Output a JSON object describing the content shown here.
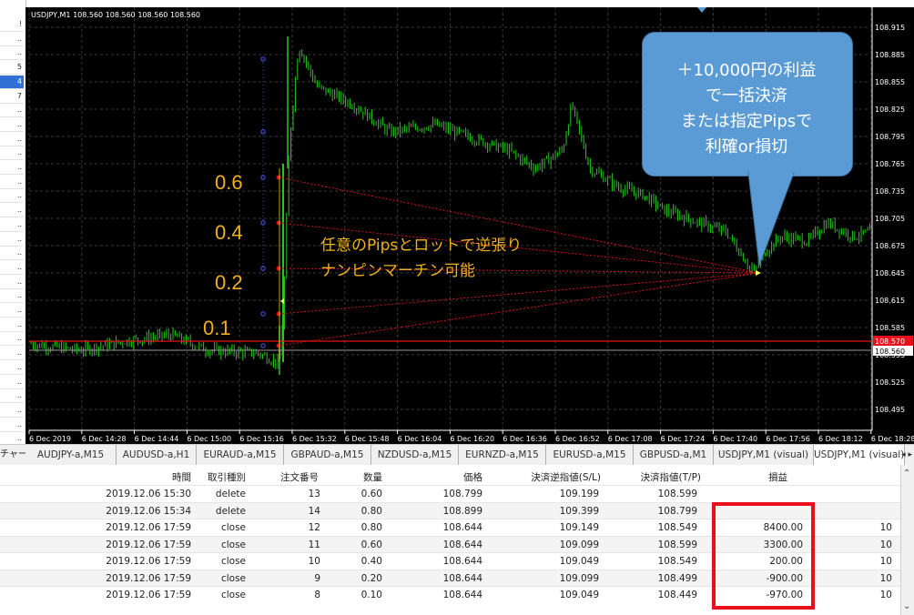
{
  "left_panel": {
    "rows": [
      "!",
      "..",
      "..",
      "5",
      "4",
      "7",
      "..",
      "..",
      "..",
      "..",
      "..",
      "..",
      "..",
      "..",
      "..",
      "..",
      "..",
      "..",
      "..",
      "..",
      "..",
      "..",
      "..",
      "..",
      "..",
      "..",
      "..",
      "..",
      "..",
      "..",
      "v"
    ]
  },
  "chart": {
    "header": "USDJPY,M1  108.560 108.560 108.560 108.560",
    "price_labels": [
      "108.915",
      "108.885",
      "108.855",
      "108.825",
      "108.795",
      "108.765",
      "108.735",
      "108.705",
      "108.675",
      "108.645",
      "108.615",
      "108.585",
      "108.555",
      "108.525",
      "108.495"
    ],
    "red_line_label": "108.570",
    "current_price_label": "108.560",
    "time_labels": [
      "6 Dec 2019",
      "6 Dec 14:28",
      "6 Dec 14:44",
      "6 Dec 15:00",
      "6 Dec 15:16",
      "6 Dec 15:32",
      "6 Dec 15:48",
      "6 Dec 16:04",
      "6 Dec 16:20",
      "6 Dec 16:36",
      "6 Dec 16:52",
      "6 Dec 17:08",
      "6 Dec 17:24",
      "6 Dec 17:40",
      "6 Dec 17:56",
      "6 Dec 18:12",
      "6 Dec 18:28"
    ],
    "levels": [
      "0.6",
      "0.4",
      "0.2",
      "0.1"
    ],
    "annotation_line1": "任意のPipsとロットで逆張り",
    "annotation_line2": "ナンピンマーチン可能",
    "callout_lines": [
      "＋10,000円の利益",
      "で一括決済",
      "または指定Pipsで",
      "利確or損切"
    ],
    "colors": {
      "bg": "#000000",
      "grid": "#3a3a3a",
      "bull": "#26c81e",
      "red_line": "#e8101a",
      "level_text": "#f0b020",
      "callout": "#5b9bd5"
    }
  },
  "tab_label": "チャート",
  "tabs": [
    "AUDJPY-a,M15",
    "AUDUSD-a,H1",
    "EURAUD-a,M15",
    "GBPAUD-a,M15",
    "NZDUSD-a,M15",
    "EURNZD-a,M15",
    "EURUSD-a,M15",
    "GBPUSD-a,M1",
    "USDJPY,M1 (visual)",
    "USDJPY,M1 (visual)"
  ],
  "table": {
    "headers": [
      "時間",
      "取引種別",
      "注文番号",
      "数量",
      "価格",
      "決済逆指値(S/L)",
      "決済指値(T/P)",
      "損益"
    ],
    "rows": [
      {
        "time": "2019.12.06 15:30",
        "type": "delete",
        "order": "13",
        "volume": "0.60",
        "price": "108.799",
        "sl": "109.199",
        "tp": "108.599",
        "profit": "",
        "extra": ""
      },
      {
        "time": "2019.12.06 15:34",
        "type": "delete",
        "order": "14",
        "volume": "0.80",
        "price": "108.899",
        "sl": "109.399",
        "tp": "108.799",
        "profit": "",
        "extra": ""
      },
      {
        "time": "2019.12.06 17:59",
        "type": "close",
        "order": "12",
        "volume": "0.80",
        "price": "108.644",
        "sl": "109.149",
        "tp": "108.549",
        "profit": "8400.00",
        "extra": "10"
      },
      {
        "time": "2019.12.06 17:59",
        "type": "close",
        "order": "11",
        "volume": "0.60",
        "price": "108.644",
        "sl": "109.099",
        "tp": "108.599",
        "profit": "3300.00",
        "extra": "10"
      },
      {
        "time": "2019.12.06 17:59",
        "type": "close",
        "order": "10",
        "volume": "0.40",
        "price": "108.644",
        "sl": "109.049",
        "tp": "108.549",
        "profit": "200.00",
        "extra": "10"
      },
      {
        "time": "2019.12.06 17:59",
        "type": "close",
        "order": "9",
        "volume": "0.20",
        "price": "108.644",
        "sl": "109.099",
        "tp": "108.499",
        "profit": "-900.00",
        "extra": "10"
      },
      {
        "time": "2019.12.06 17:59",
        "type": "close",
        "order": "8",
        "volume": "0.10",
        "price": "108.644",
        "sl": "109.049",
        "tp": "108.449",
        "profit": "-970.00",
        "extra": "10"
      }
    ]
  }
}
